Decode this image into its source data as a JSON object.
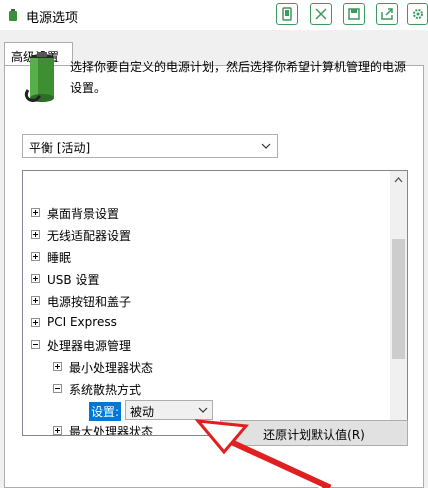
{
  "window": {
    "title": "电源选项"
  },
  "tabs": [
    {
      "label": "高级设置"
    }
  ],
  "description": "选择你要自定义的电源计划，然后选择你希望计算机管理的电源设置。",
  "plan_select": {
    "value": "平衡 [活动]"
  },
  "tree": {
    "items": [
      {
        "label": "桌面背景设置"
      },
      {
        "label": "无线适配器设置"
      },
      {
        "label": "睡眠"
      },
      {
        "label": "USB 设置"
      },
      {
        "label": "电源按钮和盖子"
      },
      {
        "label": "PCI Express"
      },
      {
        "label": "处理器电源管理"
      },
      {
        "label": "最小处理器状态"
      },
      {
        "label": "系统散热方式"
      },
      {
        "label": "最大处理器状态"
      }
    ],
    "setting": {
      "label": "设置:",
      "value": "被动"
    }
  },
  "restore_button": {
    "label": "还原计划默认值(R)"
  },
  "colors": {
    "accent": "#0078d7",
    "annotation_arrow": "#e02020",
    "toolbar_icons": "#3c9a5f"
  }
}
